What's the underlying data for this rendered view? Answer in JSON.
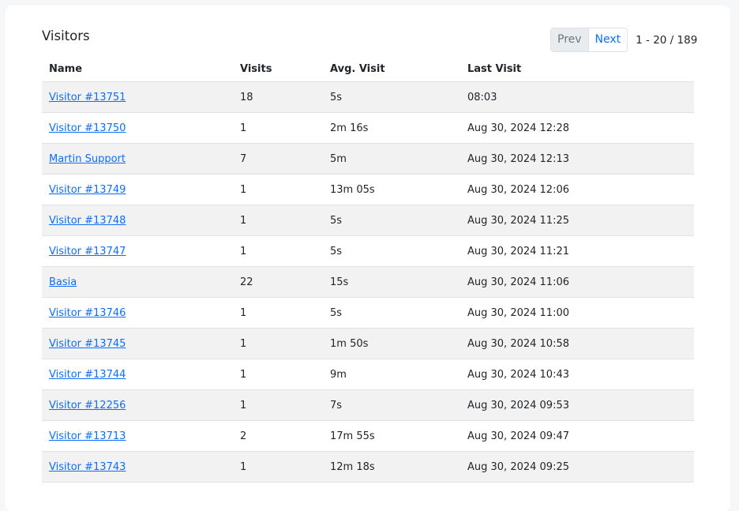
{
  "card": {
    "title": "Visitors",
    "pagination": {
      "prev_label": "Prev",
      "next_label": "Next",
      "range_text": "1 - 20 / 189"
    }
  },
  "table": {
    "columns": [
      "Name",
      "Visits",
      "Avg. Visit",
      "Last Visit"
    ],
    "rows": [
      {
        "name": "Visitor #13751",
        "visits": "18",
        "avg_visit": "5s",
        "last_visit": "08:03"
      },
      {
        "name": "Visitor #13750",
        "visits": "1",
        "avg_visit": "2m 16s",
        "last_visit": "Aug 30, 2024 12:28"
      },
      {
        "name": "Martin Support",
        "visits": "7",
        "avg_visit": "5m",
        "last_visit": "Aug 30, 2024 12:13"
      },
      {
        "name": "Visitor #13749",
        "visits": "1",
        "avg_visit": "13m 05s",
        "last_visit": "Aug 30, 2024 12:06"
      },
      {
        "name": "Visitor #13748",
        "visits": "1",
        "avg_visit": "5s",
        "last_visit": "Aug 30, 2024 11:25"
      },
      {
        "name": "Visitor #13747",
        "visits": "1",
        "avg_visit": "5s",
        "last_visit": "Aug 30, 2024 11:21"
      },
      {
        "name": "Basia",
        "visits": "22",
        "avg_visit": "15s",
        "last_visit": "Aug 30, 2024 11:06"
      },
      {
        "name": "Visitor #13746",
        "visits": "1",
        "avg_visit": "5s",
        "last_visit": "Aug 30, 2024 11:00"
      },
      {
        "name": "Visitor #13745",
        "visits": "1",
        "avg_visit": "1m 50s",
        "last_visit": "Aug 30, 2024 10:58"
      },
      {
        "name": "Visitor #13744",
        "visits": "1",
        "avg_visit": "9m",
        "last_visit": "Aug 30, 2024 10:43"
      },
      {
        "name": "Visitor #12256",
        "visits": "1",
        "avg_visit": "7s",
        "last_visit": "Aug 30, 2024 09:53"
      },
      {
        "name": "Visitor #13713",
        "visits": "2",
        "avg_visit": "17m 55s",
        "last_visit": "Aug 30, 2024 09:47"
      },
      {
        "name": "Visitor #13743",
        "visits": "1",
        "avg_visit": "12m 18s",
        "last_visit": "Aug 30, 2024 09:25"
      }
    ]
  },
  "colors": {
    "link": "#0d6efd",
    "stripe": "#f2f2f2",
    "page_background": "#f6f7f9"
  }
}
